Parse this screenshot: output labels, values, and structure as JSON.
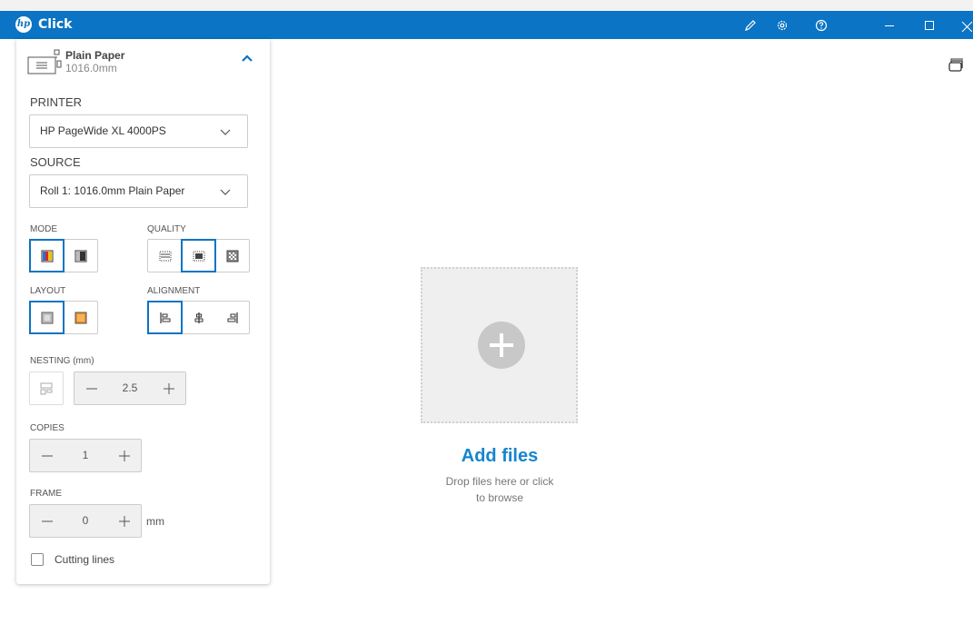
{
  "titlebar": {
    "app_title": "Click",
    "logo_text": "hp",
    "icons": [
      "pencil-icon",
      "gear-icon",
      "help-icon",
      "minimize-icon",
      "maximize-icon",
      "close-icon"
    ],
    "color": "#0b74c4"
  },
  "media": {
    "name": "Plain Paper",
    "size": "1016.0mm"
  },
  "printer": {
    "label": "PRINTER",
    "value": "HP PageWide XL 4000PS"
  },
  "source": {
    "label": "SOURCE",
    "value": "Roll 1: 1016.0mm Plain Paper"
  },
  "mode": {
    "label": "MODE",
    "options": [
      "color",
      "grayscale"
    ],
    "selected": "color"
  },
  "quality": {
    "label": "QUALITY",
    "options": [
      "fast",
      "normal",
      "best"
    ],
    "selected": "normal"
  },
  "layout": {
    "label": "LAYOUT",
    "options": [
      "portrait",
      "landscape"
    ],
    "selected": "portrait"
  },
  "alignment": {
    "label": "ALIGNMENT",
    "options": [
      "left",
      "center",
      "right"
    ],
    "selected": "left"
  },
  "nesting": {
    "label": "NESTING (mm)",
    "value": "2.5"
  },
  "copies": {
    "label": "COPIES",
    "value": "1"
  },
  "frame": {
    "label": "FRAME",
    "value": "0",
    "unit": "mm"
  },
  "cutting_lines": {
    "label": "Cutting lines",
    "checked": false
  },
  "dropzone": {
    "title": "Add files",
    "subtitle_line1": "Drop files here or click",
    "subtitle_line2": "to browse"
  },
  "accent_color": "#1585cf"
}
